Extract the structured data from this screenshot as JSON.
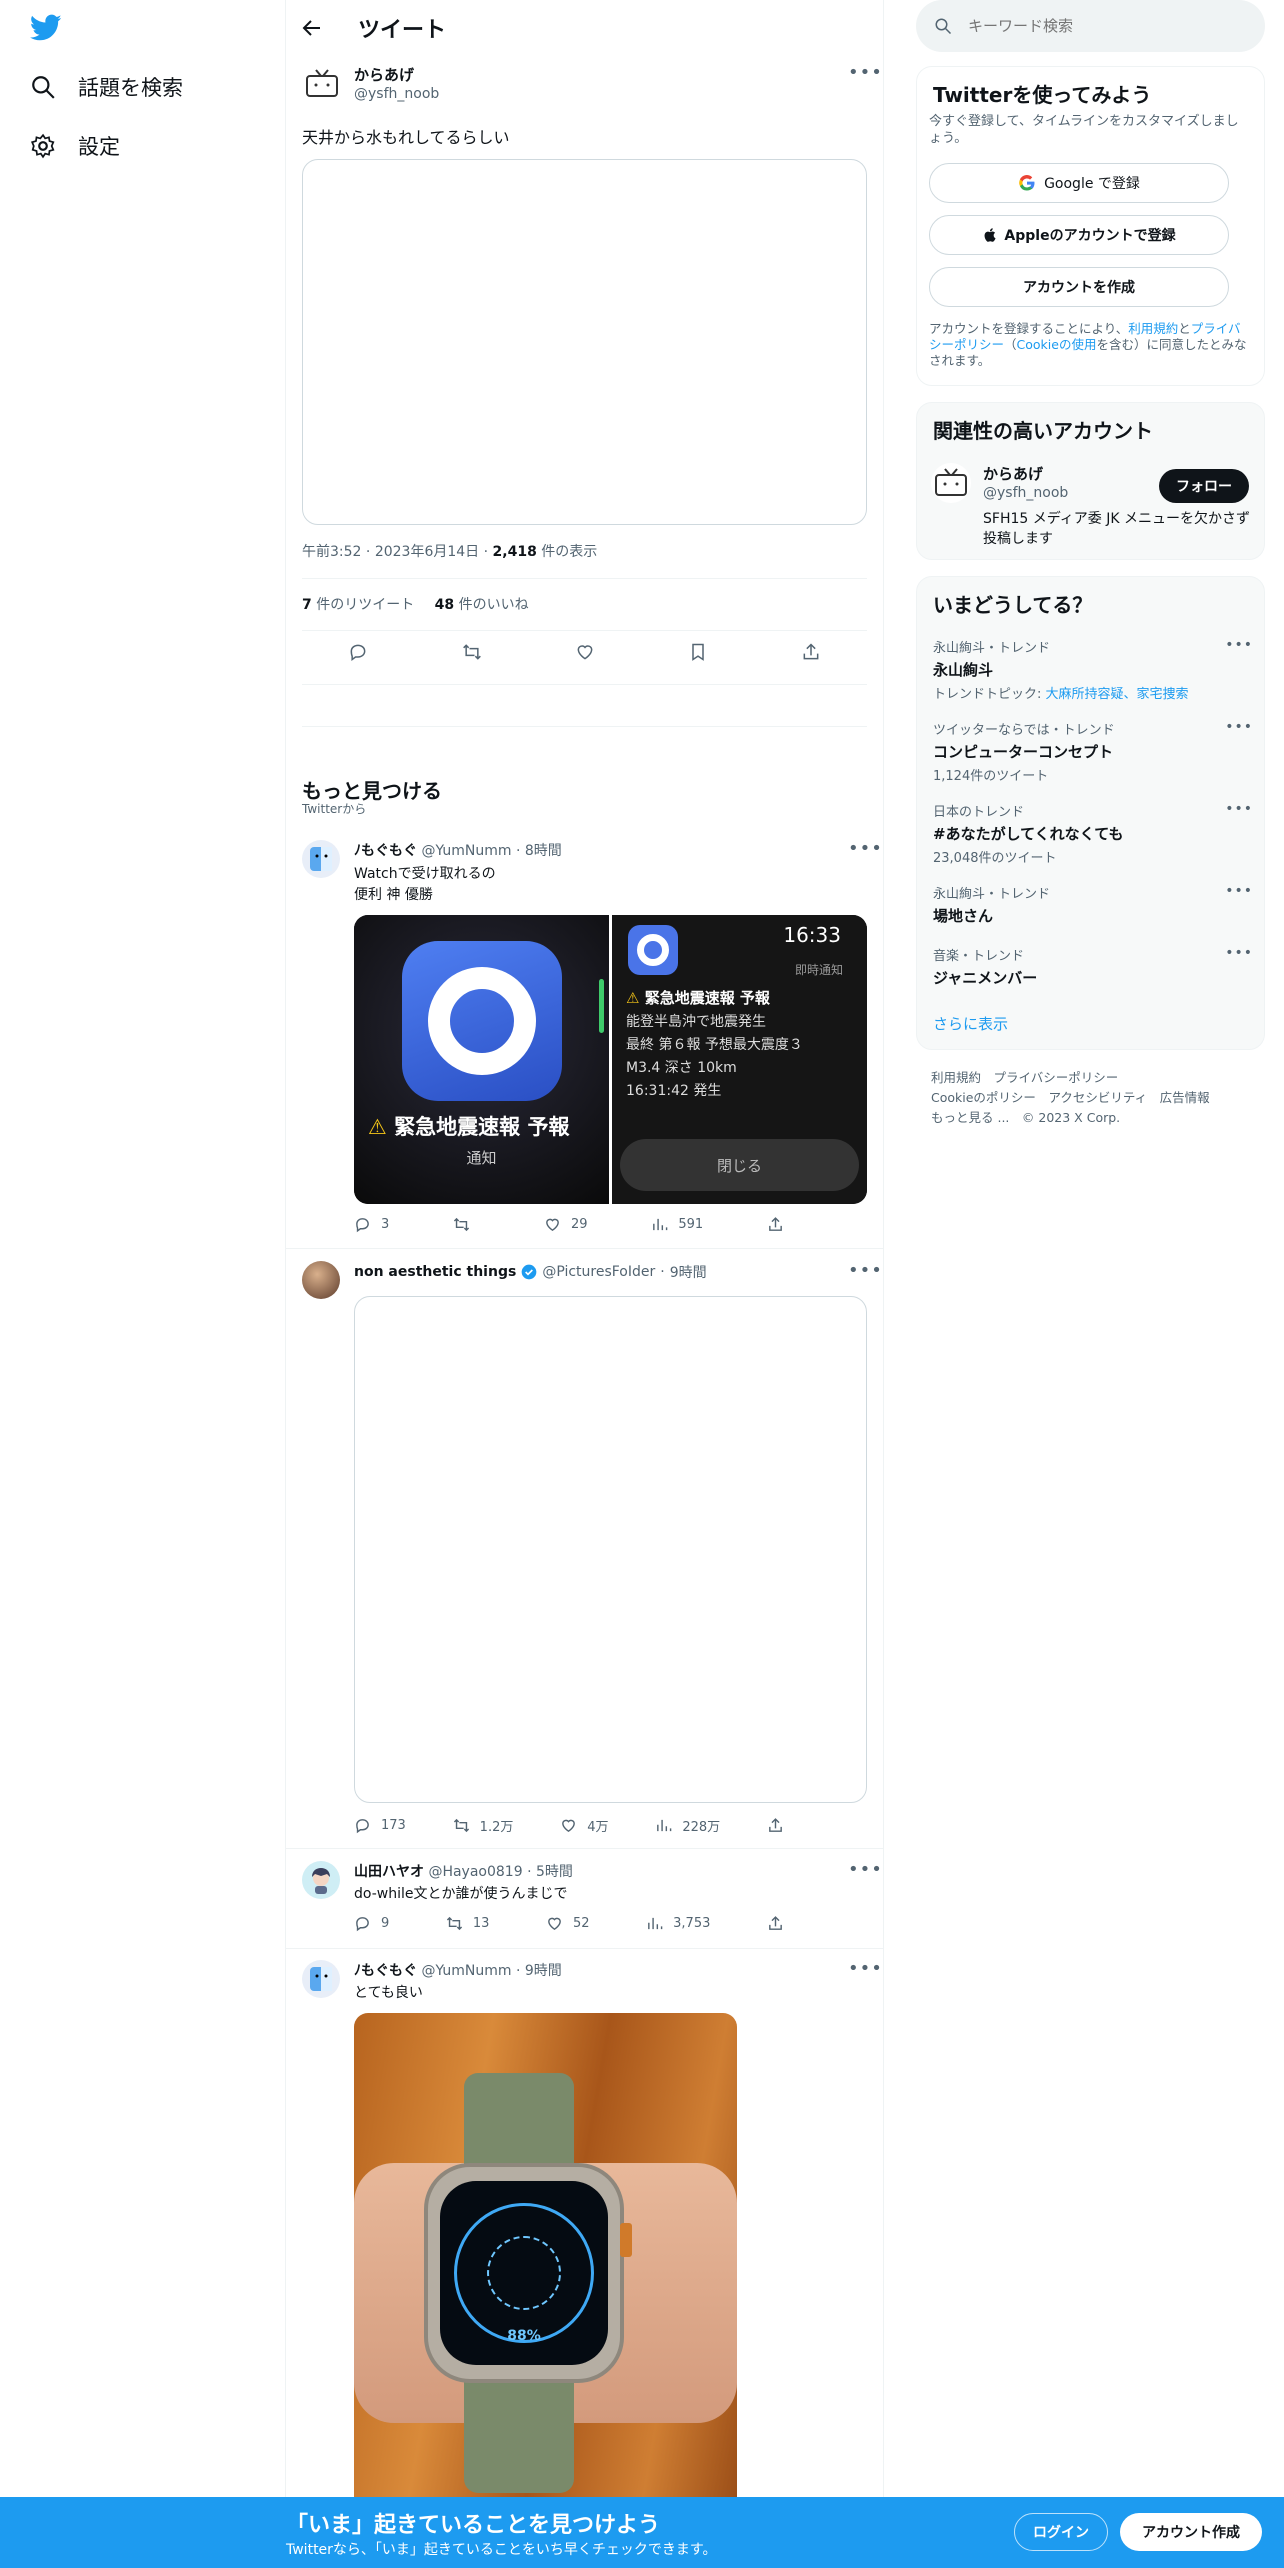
{
  "nav": {
    "explore_label": "話題を検索",
    "settings_label": "設定"
  },
  "header": {
    "title": "ツイート"
  },
  "search": {
    "placeholder": "キーワード検索"
  },
  "main_tweet": {
    "name": "からあげ",
    "handle": "@ysfh_noob",
    "text": "天井から水もれしてるらしい",
    "time": "午前3:52",
    "date": "2023年6月14日",
    "views_count": "2,418",
    "views_label": "件の表示",
    "retweets_count": "7",
    "retweets_label": "件のリツイート",
    "likes_count": "48",
    "likes_label": "件のいいね"
  },
  "discover": {
    "title": "もっと見つける",
    "subtitle": "Twitterから"
  },
  "feed": [
    {
      "name": "ﾉもぐもぐ",
      "handle": "@YumNumm",
      "time": "8時間",
      "lines": [
        "Watchで受け取れるの",
        "便利 神 優勝"
      ],
      "replies": "3",
      "retweets": "",
      "likes": "29",
      "views": "591",
      "image": {
        "left_title": "緊急地震速報 予報",
        "left_sub": "通知",
        "time": "16:33",
        "label": "即時通知",
        "title": "緊急地震速報 予報",
        "body": [
          "能登半島沖で地震発生",
          "最終 第６報 予想最大震度３",
          "M3.4 深さ 10km",
          "16:31:42 発生"
        ],
        "close": "閉じる"
      }
    },
    {
      "name": "non aesthetic things",
      "handle": "@PicturesFoIder",
      "time": "9時間",
      "replies": "173",
      "retweets": "1.2万",
      "likes": "4万",
      "views": "228万"
    },
    {
      "name": "山田ハヤオ",
      "handle": "@Hayao0819",
      "time": "5時間",
      "text": "do-while文とか誰が使うんまじで",
      "replies": "9",
      "retweets": "13",
      "likes": "52",
      "views": "3,753"
    },
    {
      "name": "ﾉもぐもぐ",
      "handle": "@YumNumm",
      "time": "9時間",
      "text": "とても良い",
      "watch_pct": "88%"
    }
  ],
  "signup": {
    "title": "Twitterを使ってみよう",
    "subtitle": "今すぐ登録して、タイムラインをカスタマイズしましょう。",
    "google": "Google で登録",
    "apple": "Appleのアカウントで登録",
    "create": "アカウントを作成",
    "legal_1": "アカウントを登録することにより、",
    "terms": "利用規約",
    "and": "と",
    "privacy": "プライバシーポリシー",
    "cookie_open": "（",
    "cookie": "Cookieの使用",
    "legal_2": "を含む）に同意したとみなされます。"
  },
  "related": {
    "title": "関連性の高いアカウント",
    "name": "からあげ",
    "handle": "@ysfh_noob",
    "follow": "フォロー",
    "bio": "SFH15 メディア委 JK メニューを欠かさず投稿します"
  },
  "trends": {
    "title": "いまどうしてる？",
    "items": [
      {
        "meta": "永山絢斗・トレンド",
        "name": "永山絢斗",
        "topic_label": "トレンドトピック: ",
        "topic": "大麻所持容疑、家宅捜索"
      },
      {
        "meta": "ツイッターならでは・トレンド",
        "name": "コンピューターコンセプト",
        "count": "1,124件のツイート"
      },
      {
        "meta": "日本のトレンド",
        "name": "#あなたがしてくれなくても",
        "count": "23,048件のツイート"
      },
      {
        "meta": "永山絢斗・トレンド",
        "name": "場地さん"
      },
      {
        "meta": "音楽・トレンド",
        "name": "ジャニメンバー"
      }
    ],
    "more": "さらに表示"
  },
  "footer": {
    "line1": [
      "利用規約",
      "プライバシーポリシー"
    ],
    "line2": [
      "Cookieのポリシー",
      "アクセシビリティ",
      "広告情報"
    ],
    "more": "もっと見る ...",
    "copyright": "© 2023 X Corp."
  },
  "bottom": {
    "title": "「いま」起きていることを見つけよう",
    "subtitle": "Twitterなら、「いま」起きていることをいち早くチェックできます。",
    "login": "ログイン",
    "signup": "アカウント作成"
  },
  "colors": {
    "accent": "#1d9bf0",
    "text": "#0f1419",
    "secondary": "#536471"
  }
}
